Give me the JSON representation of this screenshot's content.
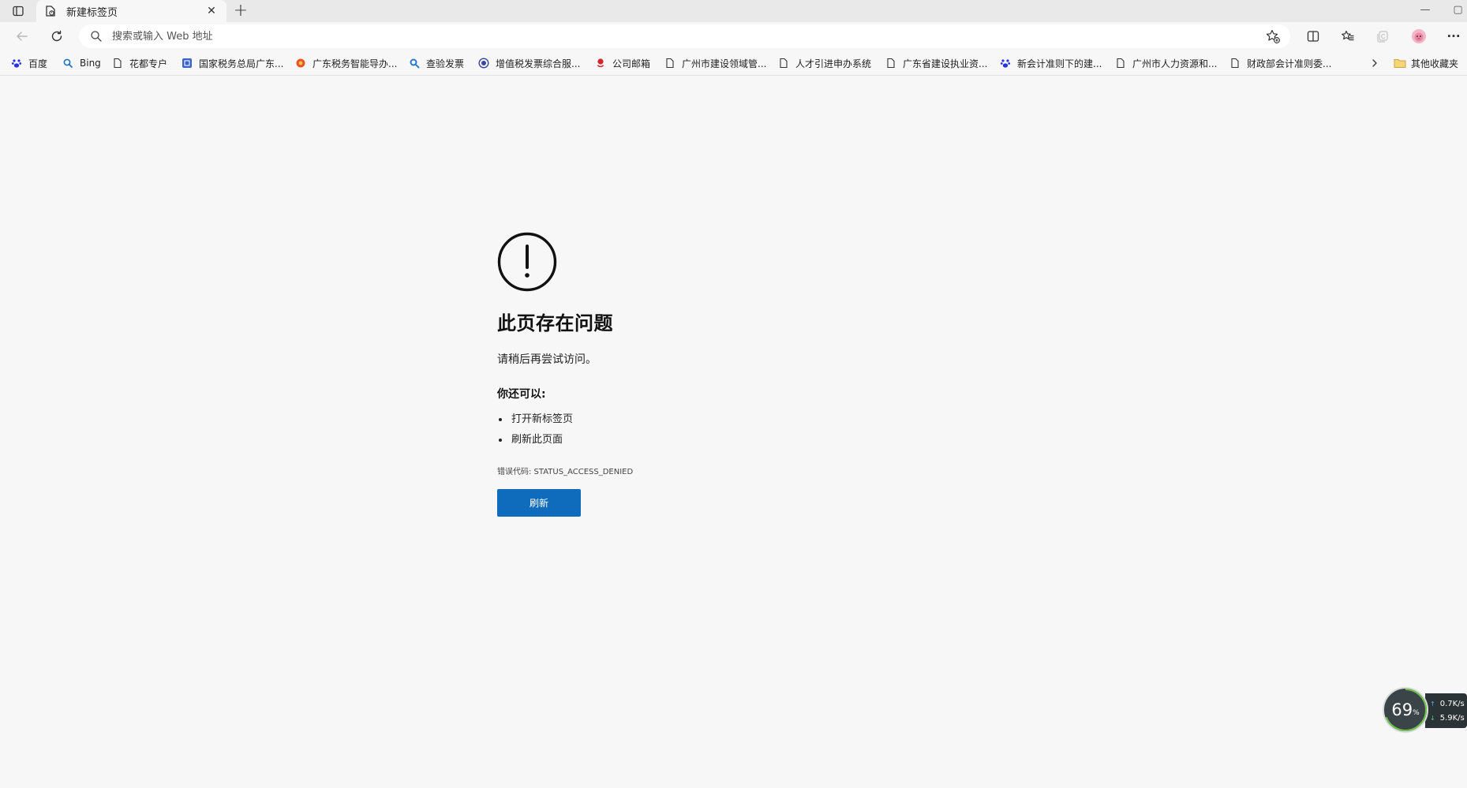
{
  "tab": {
    "title": "新建标签页",
    "close_glyph": "✕"
  },
  "newtab_glyph": "+",
  "window": {
    "minimize_glyph": "—",
    "restore_glyph": "▢"
  },
  "address": {
    "placeholder": "搜索或输入 Web 地址",
    "value": ""
  },
  "toolbar": {
    "more_glyph": "···"
  },
  "bookmarks": {
    "items": [
      {
        "label": "百度",
        "icon": "baidu-paw-icon"
      },
      {
        "label": "Bing",
        "icon": "bing-search-icon"
      },
      {
        "label": "花都专户",
        "icon": "page-icon"
      },
      {
        "label": "国家税务总局广东...",
        "icon": "tax-bureau-icon"
      },
      {
        "label": "广东税务智能导办...",
        "icon": "tax-guide-icon"
      },
      {
        "label": "查验发票",
        "icon": "invoice-check-icon"
      },
      {
        "label": "增值税发票综合服...",
        "icon": "vat-service-icon"
      },
      {
        "label": "公司邮箱",
        "icon": "mail-icon"
      },
      {
        "label": "广州市建设领域管...",
        "icon": "page-icon"
      },
      {
        "label": "人才引进申办系统",
        "icon": "page-icon"
      },
      {
        "label": "广东省建设执业资...",
        "icon": "page-icon"
      },
      {
        "label": "新会计准则下的建...",
        "icon": "baidu-paw-icon"
      },
      {
        "label": "广州市人力资源和...",
        "icon": "page-icon"
      },
      {
        "label": "财政部会计准则委...",
        "icon": "page-icon"
      }
    ],
    "other_label": "其他收藏夹"
  },
  "error": {
    "title": "此页存在问题",
    "subtitle": "请稍后再尝试访问。",
    "also_heading": "你还可以:",
    "suggestions": [
      "打开新标签页",
      "刷新此页面"
    ],
    "code_label": "错误代码: STATUS_ACCESS_DENIED",
    "refresh_label": "刷新"
  },
  "netwidget": {
    "percent": "69",
    "unit": "%",
    "up_arrow": "↑",
    "down_arrow": "↓",
    "upload": "0.7K/s",
    "download": "5.9K/s"
  },
  "colors": {
    "accent": "#0f6cbd",
    "page_bg": "#f7f7f7",
    "tabstrip_bg": "#e9e9e9"
  }
}
